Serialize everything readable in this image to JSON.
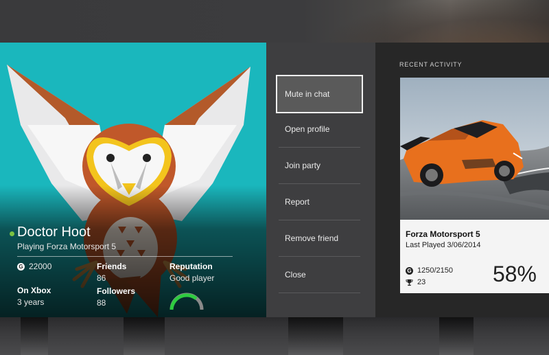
{
  "profile": {
    "gamertag": "Doctor Hoot",
    "presence": "Playing Forza Motorsport 5",
    "gamerscore": "22000",
    "friends_label": "Friends",
    "friends_value": "86",
    "reputation_label": "Reputation",
    "reputation_value": "Good player",
    "on_xbox_label": "On Xbox",
    "on_xbox_value": "3 years",
    "followers_label": "Followers",
    "followers_value": "88",
    "gamerscore_icon_letter": "G",
    "colors": {
      "card_background": "#1ab7bd",
      "presence_online": "#7cc242",
      "reputation_good": "#2ecc40"
    }
  },
  "menu": {
    "items": [
      {
        "label": "Mute in chat",
        "focused": true
      },
      {
        "label": "Open profile",
        "focused": false
      },
      {
        "label": "Join party",
        "focused": false
      },
      {
        "label": "Report",
        "focused": false
      },
      {
        "label": "Remove friend",
        "focused": false
      },
      {
        "label": "Close",
        "focused": false
      }
    ]
  },
  "activity": {
    "heading": "RECENT ACTIVITY",
    "game": {
      "title": "Forza Motorsport 5",
      "last_played": "Last Played 3/06/2014",
      "gamerscore": "1250/2150",
      "achievements": "23",
      "completion": "58%",
      "gamerscore_icon_letter": "G"
    }
  }
}
